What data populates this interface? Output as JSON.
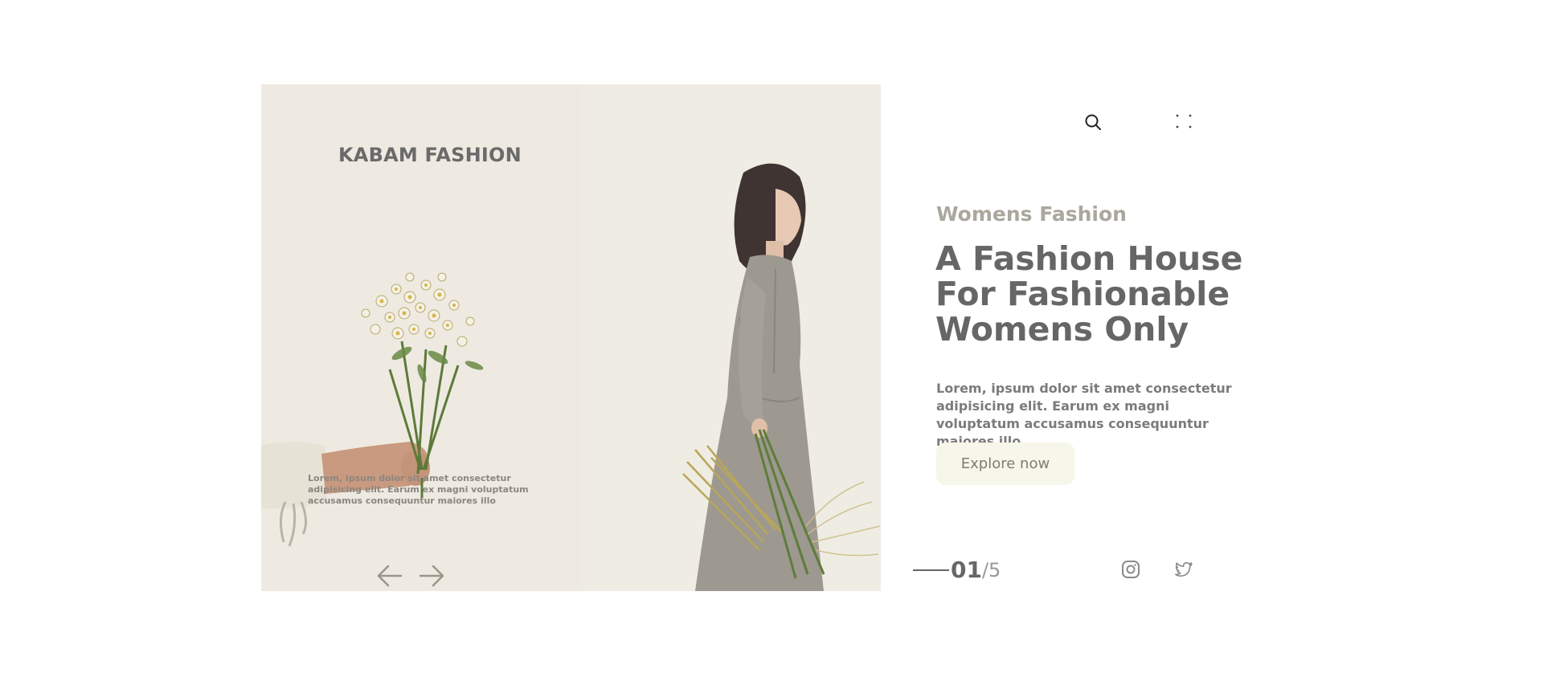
{
  "brand": {
    "name": "KABAM FASHION"
  },
  "hero": {
    "copy": "Lorem, ipsum dolor sit amet consectetur adipisicing elit. Earum ex magni voluptatum accusamus consequuntur maiores illo",
    "prev_icon": "arrow-left-icon",
    "next_icon": "arrow-right-icon"
  },
  "header": {
    "search_icon": "search-icon",
    "menu_icon": "grid-dots-icon"
  },
  "content": {
    "eyebrow": "Womens Fashion",
    "headline": "A Fashion House For Fashionable Womens Only",
    "description": "Lorem, ipsum dolor sit amet consectetur adipisicing elit. Earum ex magni voluptatum accusamus consequuntur maiores illo",
    "cta_label": "Explore now"
  },
  "pagination": {
    "current": "01",
    "total": "/5"
  },
  "social": {
    "instagram_icon": "instagram-icon",
    "twitter_icon": "twitter-icon"
  },
  "colors": {
    "panel_bg": "#efece3",
    "cta_bg": "#f7f6ea",
    "text_primary": "#666666",
    "text_muted": "#aaa79e"
  }
}
